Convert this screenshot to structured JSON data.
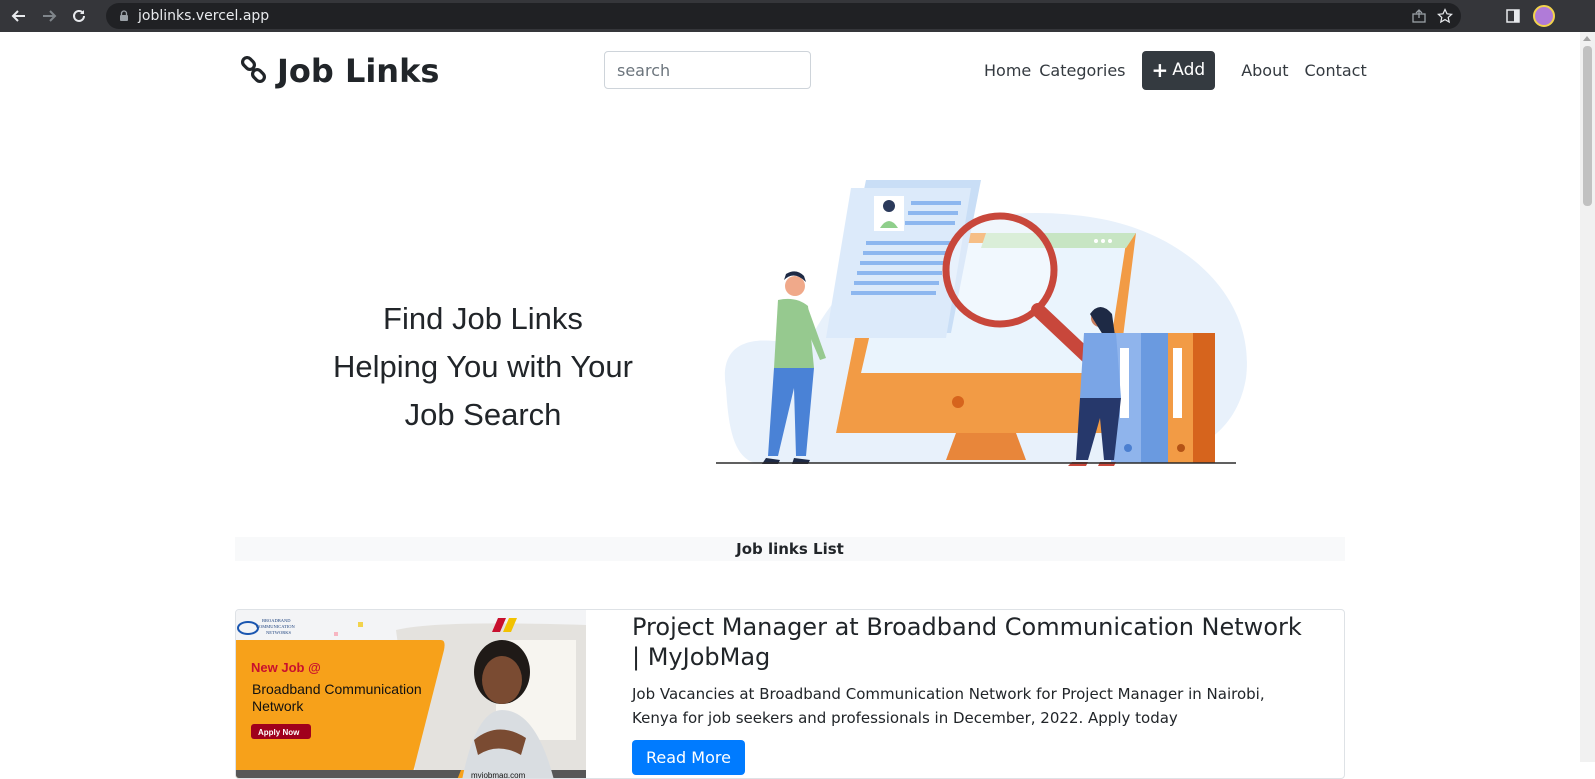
{
  "browser": {
    "url": "joblinks.vercel.app",
    "back_icon": "arrow-left-icon",
    "forward_icon": "arrow-right-icon",
    "reload_icon": "reload-icon"
  },
  "header": {
    "brand": "Job Links",
    "search_placeholder": "search",
    "nav": {
      "home": "Home",
      "categories": "Categories",
      "add": "Add",
      "about": "About",
      "contact": "Contact"
    }
  },
  "hero": {
    "line1": "Find Job Links",
    "line2": "Helping You with Your",
    "line3": "Job Search"
  },
  "list": {
    "title": "Job links List",
    "items": [
      {
        "title": "Project Manager at Broadband Communication Network | MyJobMag",
        "description": "Job Vacancies at Broadband Communication Network for Project Manager in Nairobi, Kenya for job seekers and professionals in December, 2022. Apply today",
        "button": "Read More",
        "image": {
          "new_job": "New Job @",
          "company_line1": "Broadband Communication",
          "company_line2": "Network",
          "apply": "Apply Now",
          "site": "myjobmag.com",
          "logo_text": "BROADBAND COMMUNICATION NETWORKS"
        }
      }
    ]
  },
  "colors": {
    "primary": "#007bff",
    "dark": "#343a40",
    "light_bg": "#f8f9fa",
    "ad_orange": "#f7a11a"
  }
}
